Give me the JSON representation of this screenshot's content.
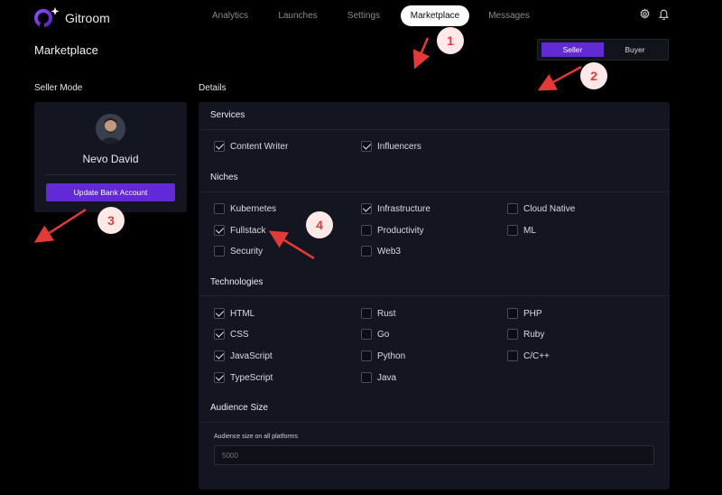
{
  "app": {
    "name": "Gitroom"
  },
  "nav": {
    "items": [
      {
        "label": "Analytics",
        "active": false
      },
      {
        "label": "Launches",
        "active": false
      },
      {
        "label": "Settings",
        "active": false
      },
      {
        "label": "Marketplace",
        "active": true
      },
      {
        "label": "Messages",
        "active": false
      }
    ],
    "icons": [
      "gear-icon",
      "bell-icon"
    ]
  },
  "page": {
    "title": "Marketplace"
  },
  "mode_toggle": {
    "seller": "Seller",
    "buyer": "Buyer",
    "selected": "Seller"
  },
  "seller_mode": {
    "heading": "Seller Mode",
    "name": "Nevo David",
    "button": "Update Bank Account"
  },
  "details": {
    "heading": "Details",
    "services": {
      "title": "Services",
      "items": [
        {
          "label": "Content Writer",
          "checked": true
        },
        {
          "label": "Influencers",
          "checked": true
        }
      ]
    },
    "niches": {
      "title": "Niches",
      "items": [
        {
          "label": "Kubernetes",
          "checked": false
        },
        {
          "label": "Infrastructure",
          "checked": true
        },
        {
          "label": "Cloud Native",
          "checked": false
        },
        {
          "label": "Fullstack",
          "checked": true
        },
        {
          "label": "Productivity",
          "checked": false
        },
        {
          "label": "ML",
          "checked": false
        },
        {
          "label": "Security",
          "checked": false
        },
        {
          "label": "Web3",
          "checked": false
        }
      ]
    },
    "technologies": {
      "title": "Technologies",
      "items": [
        {
          "label": "HTML",
          "checked": true
        },
        {
          "label": "Rust",
          "checked": false
        },
        {
          "label": "PHP",
          "checked": false
        },
        {
          "label": "CSS",
          "checked": true
        },
        {
          "label": "Go",
          "checked": false
        },
        {
          "label": "Ruby",
          "checked": false
        },
        {
          "label": "JavaScript",
          "checked": true
        },
        {
          "label": "Python",
          "checked": false
        },
        {
          "label": "C/C++",
          "checked": false
        },
        {
          "label": "TypeScript",
          "checked": true
        },
        {
          "label": "Java",
          "checked": false
        }
      ]
    },
    "audience": {
      "title": "Audience Size",
      "label": "Audience size on all platforms",
      "placeholder": "5000"
    }
  },
  "annotations": [
    "1",
    "2",
    "3",
    "4"
  ],
  "colors": {
    "accent": "#612ad5",
    "background": "#000000",
    "panel": "#131620",
    "annotation": "#e53935"
  }
}
